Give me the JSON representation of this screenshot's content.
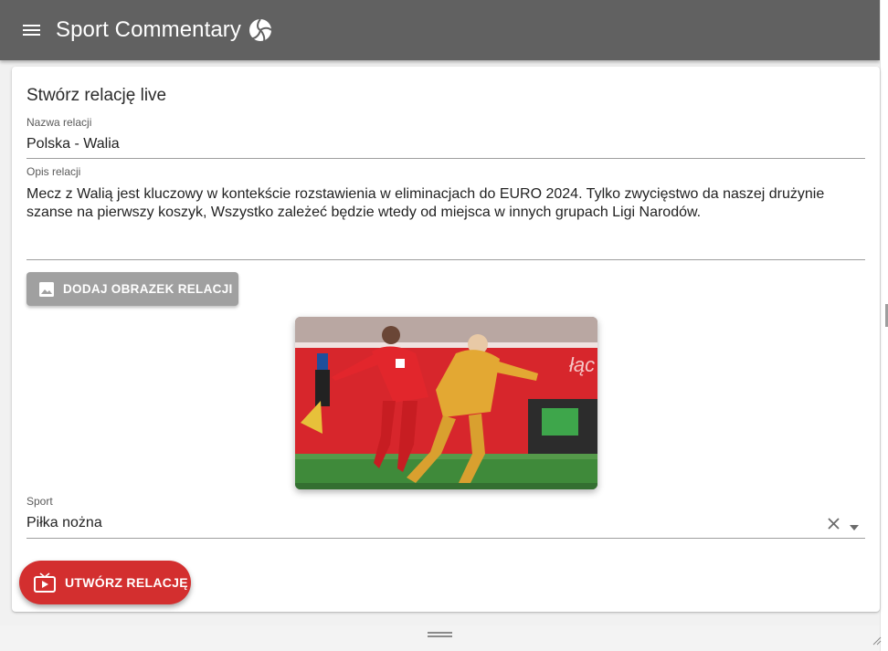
{
  "app": {
    "title": "Sport Commentary"
  },
  "form": {
    "heading": "Stwórz relację live",
    "name_label": "Nazwa relacji",
    "name_value": "Polska - Walia",
    "desc_label": "Opis relacji",
    "desc_value": "Mecz z Walią jest kluczowy w kontekście rozstawienia w eliminacjach do EURO 2024. Tylko zwycięstwo da naszej drużynie szanse na pierwszy koszyk, Wszystko zależeć będzie wtedy od miejsca w innych grupach Ligi Narodów.",
    "upload_label": "DODAJ OBRAZEK RELACJI",
    "sport_label": "Sport",
    "sport_value": "Piłka nożna",
    "submit_label": "UTWÓRZ RELACJĘ"
  },
  "icons": {
    "menu": "menu-icon",
    "logo": "volleyball-icon",
    "upload": "image-icon",
    "clear": "close-icon",
    "dropdown": "arrow-drop-down-icon",
    "submit": "live-tv-icon"
  },
  "colors": {
    "appbar": "#616161",
    "primary_action": "#d32f2f",
    "upload_button": "#a0a0a0"
  }
}
